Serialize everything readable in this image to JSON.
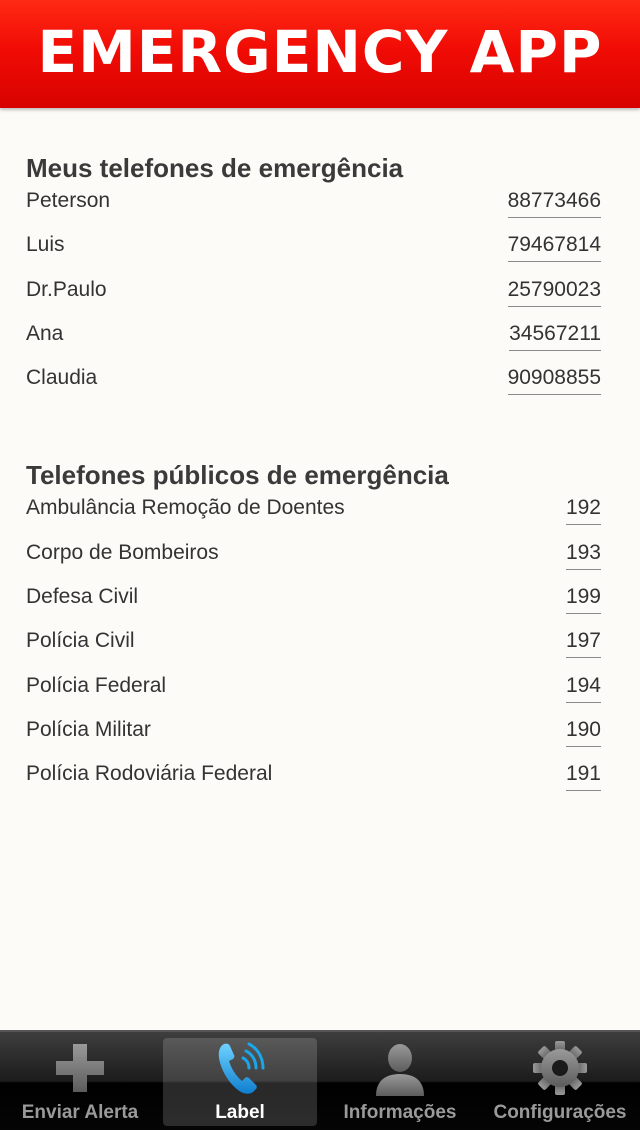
{
  "header": {
    "title": "EMERGENCY APP"
  },
  "my_phones": {
    "title": "Meus telefones de emergência",
    "items": [
      {
        "name": "Peterson",
        "number": "88773466"
      },
      {
        "name": "Luis",
        "number": "79467814"
      },
      {
        "name": "Dr.Paulo",
        "number": "25790023"
      },
      {
        "name": "Ana",
        "number": "34567211"
      },
      {
        "name": "Claudia",
        "number": "90908855"
      }
    ]
  },
  "public_phones": {
    "title": "Telefones públicos de emergência",
    "items": [
      {
        "name": "Ambulância Remoção de Doentes",
        "number": "192"
      },
      {
        "name": "Corpo de Bombeiros",
        "number": "193"
      },
      {
        "name": "Defesa Civil",
        "number": "199"
      },
      {
        "name": "Polícia Civil",
        "number": "197"
      },
      {
        "name": "Polícia Federal",
        "number": "194"
      },
      {
        "name": "Polícia Militar",
        "number": "190"
      },
      {
        "name": "Polícia Rodoviária Federal",
        "number": "191"
      }
    ]
  },
  "tabbar": {
    "tabs": [
      {
        "label": "Enviar Alerta",
        "icon": "plus-icon",
        "active": false
      },
      {
        "label": "Label",
        "icon": "phone-icon",
        "active": true
      },
      {
        "label": "Informações",
        "icon": "person-icon",
        "active": false
      },
      {
        "label": "Configurações",
        "icon": "gear-icon",
        "active": false
      }
    ]
  },
  "colors": {
    "header_red": "#e60a02",
    "active_icon_blue": "#1aa6e8"
  }
}
